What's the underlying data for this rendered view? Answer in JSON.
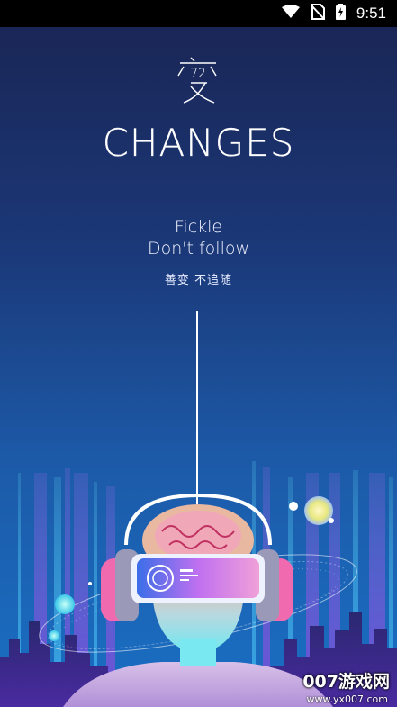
{
  "status_bar": {
    "time": "9:51",
    "icons": [
      "wifi-icon",
      "no-sim-icon",
      "battery-charging-icon"
    ]
  },
  "app": {
    "logo_glyph": "变",
    "title": "CHANGES",
    "tagline_line1": "Fickle",
    "tagline_line2": "Don't follow",
    "tagline_cn": "善变 不追随"
  },
  "watermark": {
    "logo": "007游戏网",
    "url": "www.yx007.com"
  },
  "colors": {
    "background_top": "#1a2452",
    "background_bottom": "#1a6fc4",
    "accent_pink": "#f06ab0",
    "accent_purple": "#8a4fd8",
    "accent_cyan": "#5ee0f0"
  }
}
